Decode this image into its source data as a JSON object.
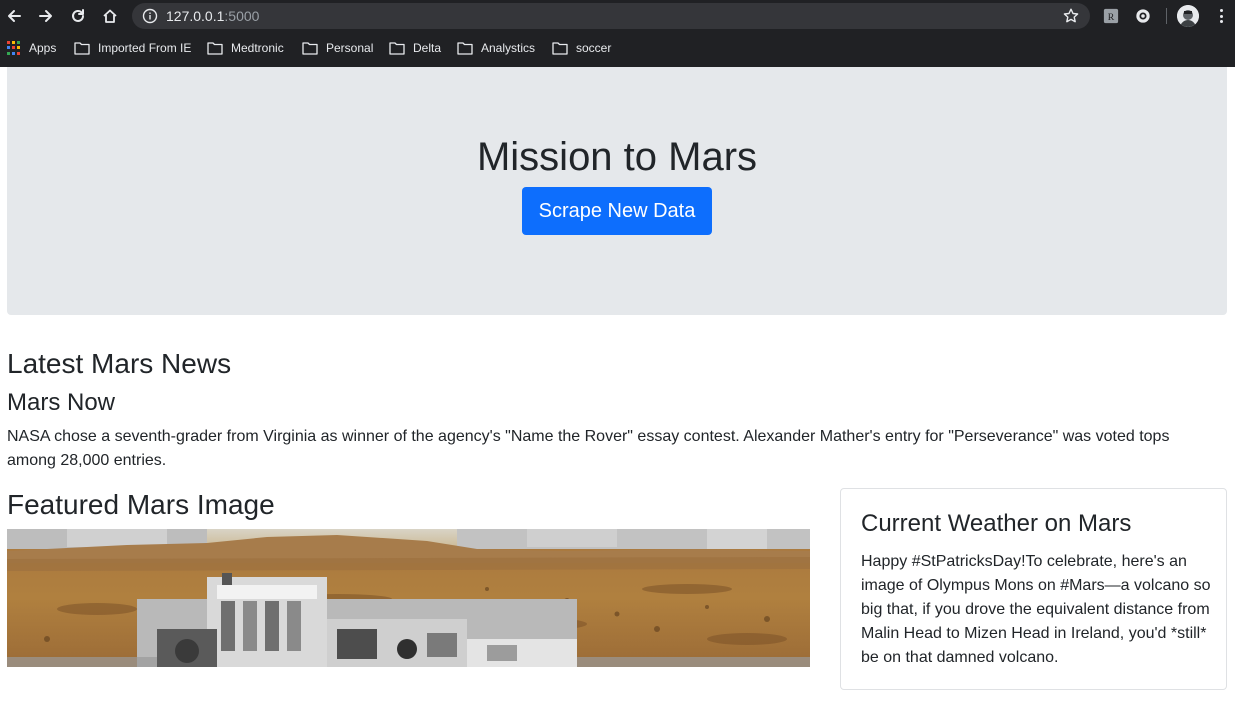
{
  "browser": {
    "url_host": "127.0.0.1",
    "url_port": ":5000",
    "bookmarks": [
      {
        "label": "Apps"
      },
      {
        "label": "Imported From IE"
      },
      {
        "label": "Medtronic"
      },
      {
        "label": "Personal"
      },
      {
        "label": "Delta"
      },
      {
        "label": "Analystics"
      },
      {
        "label": "soccer"
      }
    ],
    "icons": [
      "back-icon",
      "forward-icon",
      "reload-icon",
      "home-icon",
      "info-icon",
      "star-icon",
      "extension-icon",
      "profile-avatar",
      "menu-icon"
    ]
  },
  "page": {
    "title": "Mission to Mars",
    "scrape_button": "Scrape New Data",
    "news_section_heading": "Latest Mars News",
    "news_title": "Mars Now",
    "news_paragraph": "NASA chose a seventh-grader from Virginia as winner of the agency's \"Name the Rover\" essay contest. Alexander Mather's entry for \"Perseverance\" was voted tops among 28,000 entries.",
    "featured_heading": "Featured Mars Image",
    "weather_heading": "Current Weather on Mars",
    "weather_text": "Happy #StPatricksDay!To celebrate, here's an image of Olympus Mons on #Mars—a volcano so big that, if you drove the equivalent distance from Malin Head to Mizen Head in Ireland, you'd *still* be on that damned volcano."
  },
  "colors": {
    "chrome_bg": "#202124",
    "jumbotron_bg": "#e5e8eb",
    "primary_button": "#0d6efd",
    "text": "#212529"
  }
}
